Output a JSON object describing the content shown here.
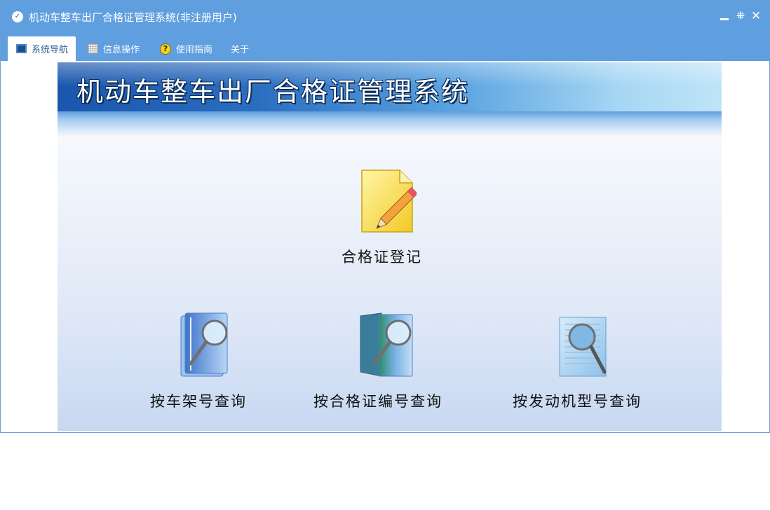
{
  "window": {
    "title": "机动车整车出厂合格证管理系统(非注册用户)",
    "icon": "app-logo-icon",
    "controls": {
      "minimize": "minimize-icon",
      "restore": "restore-icon",
      "close": "close-icon"
    }
  },
  "menu": {
    "items": [
      {
        "label": "系统导航",
        "icon": "screen-icon",
        "active": true
      },
      {
        "label": "信息操作",
        "icon": "grid-icon",
        "active": false
      },
      {
        "label": "使用指南",
        "icon": "help-icon",
        "active": false
      },
      {
        "label": "关于",
        "active": false
      }
    ]
  },
  "banner": {
    "title": "机动车整车出厂合格证管理系统"
  },
  "tiles": {
    "register": {
      "label": "合格证登记",
      "icon": "notepad-pencil-icon"
    },
    "by_frame": {
      "label": "按车架号查询",
      "icon": "document-magnifier-icon"
    },
    "by_cert": {
      "label": "按合格证编号查询",
      "icon": "book-magnifier-icon"
    },
    "by_engine": {
      "label": "按发动机型号查询",
      "icon": "page-magnifier-icon"
    }
  },
  "colors": {
    "titlebar": "#5f9fdf",
    "banner_start": "#1a56ac",
    "banner_end": "#bfe4f8"
  }
}
